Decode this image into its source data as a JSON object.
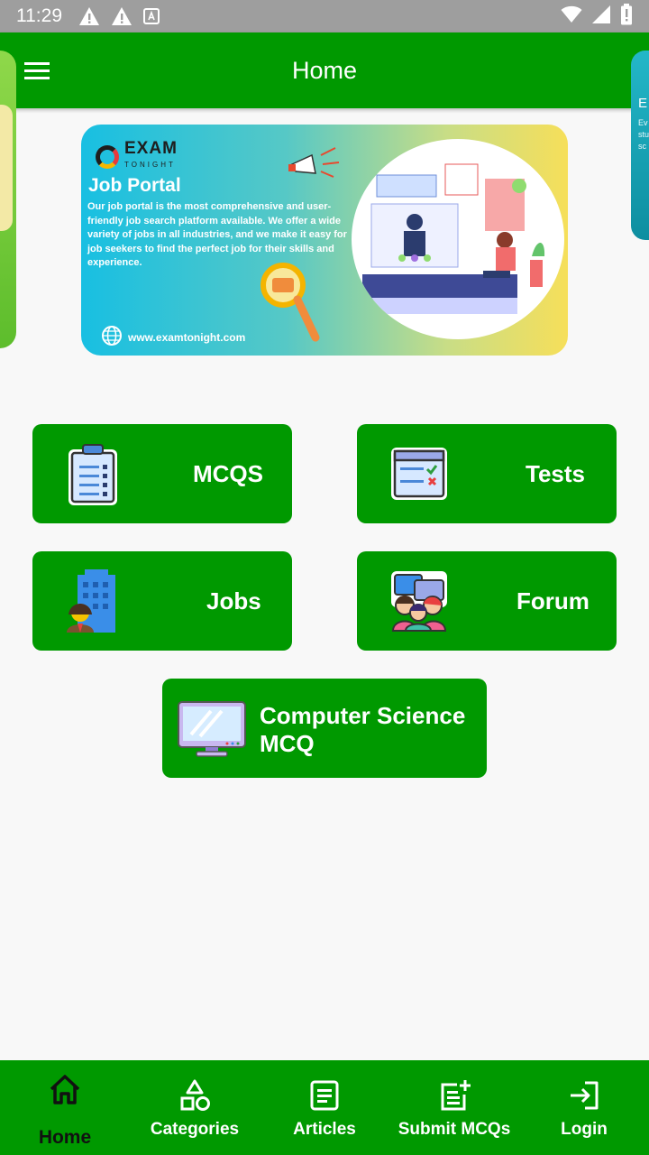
{
  "status_bar": {
    "time": "11:29"
  },
  "app_bar": {
    "title": "Home"
  },
  "banner": {
    "logo_text": "EXAM",
    "logo_subtext": "TONIGHT",
    "heading": "Job Portal",
    "body": "Our job portal is the most comprehensive and user-friendly job search platform available. We offer a wide variety of jobs in all industries, and we make it easy for job seekers to find the perfect job for their skills and experience.",
    "website": "www.examtonight.com"
  },
  "peek_right": {
    "title": "E",
    "snippet": "Ev stu sc"
  },
  "tiles": {
    "mcqs": "MCQS",
    "tests": "Tests",
    "jobs": "Jobs",
    "forum": "Forum",
    "cs_line1": "Computer Science",
    "cs_line2": "MCQ"
  },
  "bottom_nav": {
    "home": "Home",
    "categories": "Categories",
    "articles": "Articles",
    "submit": "Submit MCQs",
    "login": "Login"
  },
  "colors": {
    "primary": "#009900",
    "active_nav_label": "#111111",
    "background": "#f8f8f8"
  }
}
